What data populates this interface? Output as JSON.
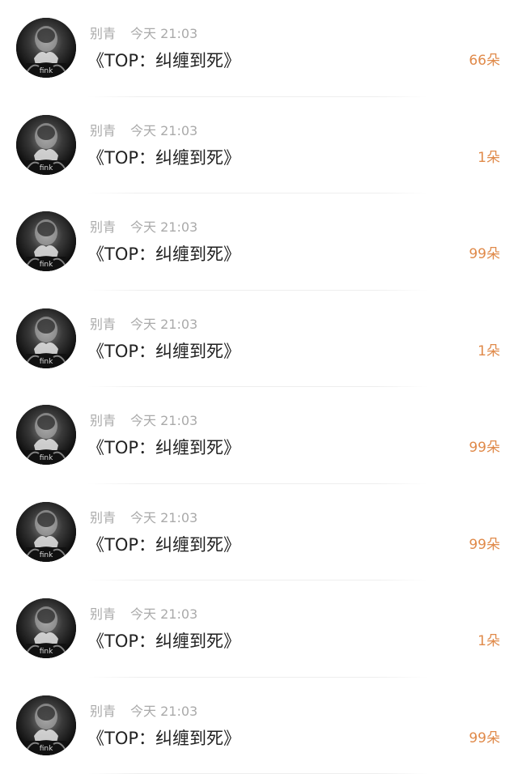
{
  "comments": [
    {
      "name": "别青",
      "time": "今天 21:03",
      "text": "《TOP：纠缠到死》",
      "count": "66朵"
    },
    {
      "name": "别青",
      "time": "今天 21:03",
      "text": "《TOP：纠缠到死》",
      "count": "1朵"
    },
    {
      "name": "别青",
      "time": "今天 21:03",
      "text": "《TOP：纠缠到死》",
      "count": "99朵"
    },
    {
      "name": "别青",
      "time": "今天 21:03",
      "text": "《TOP：纠缠到死》",
      "count": "1朵"
    },
    {
      "name": "别青",
      "time": "今天 21:03",
      "text": "《TOP：纠缠到死》",
      "count": "99朵"
    },
    {
      "name": "别青",
      "time": "今天 21:03",
      "text": "《TOP：纠缠到死》",
      "count": "99朵"
    },
    {
      "name": "别青",
      "time": "今天 21:03",
      "text": "《TOP：纠缠到死》",
      "count": "1朵"
    },
    {
      "name": "别青",
      "time": "今天 21:03",
      "text": "《TOP：纠缠到死》",
      "count": "99朵"
    }
  ],
  "colors": {
    "background": "#ffffff",
    "meta_text": "#aaaaaa",
    "body_text": "#222222",
    "count_accent": "#e08a4a",
    "divider": "#eeeeee"
  },
  "icons": {
    "avatar": "user-avatar-photo"
  }
}
